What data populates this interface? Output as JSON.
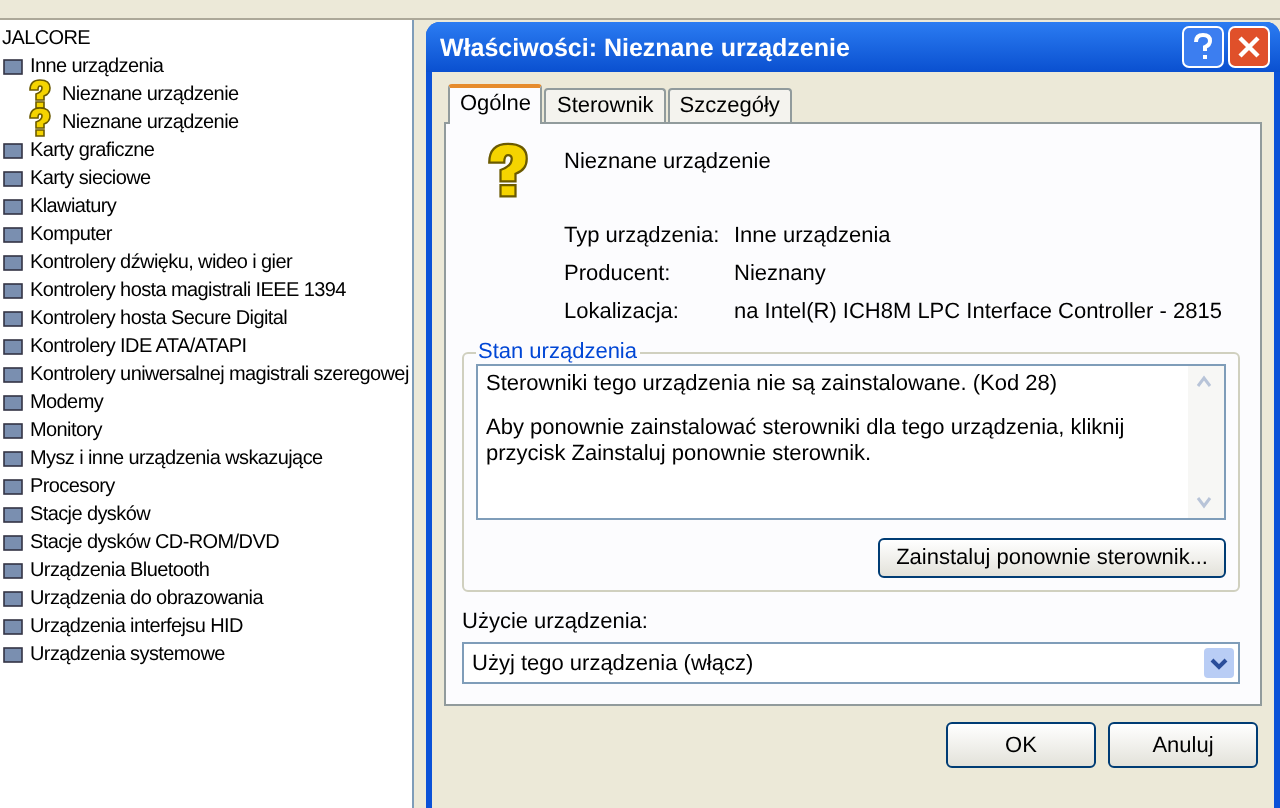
{
  "tree": {
    "label": "JALCORE",
    "children": [
      {
        "label": "Inne urządzenia",
        "children": [
          {
            "label": "Nieznane urządzenie",
            "kind": "unknown"
          },
          {
            "label": "Nieznane urządzenie",
            "kind": "unknown"
          }
        ]
      },
      {
        "label": "Karty graficzne"
      },
      {
        "label": "Karty sieciowe"
      },
      {
        "label": "Klawiatury"
      },
      {
        "label": "Komputer"
      },
      {
        "label": "Kontrolery dźwięku, wideo i gier"
      },
      {
        "label": "Kontrolery hosta magistrali IEEE 1394"
      },
      {
        "label": "Kontrolery hosta Secure Digital"
      },
      {
        "label": "Kontrolery IDE ATA/ATAPI"
      },
      {
        "label": "Kontrolery uniwersalnej magistrali szeregowej"
      },
      {
        "label": "Modemy"
      },
      {
        "label": "Monitory"
      },
      {
        "label": "Mysz i inne urządzenia wskazujące"
      },
      {
        "label": "Procesory"
      },
      {
        "label": "Stacje dysków"
      },
      {
        "label": "Stacje dysków CD-ROM/DVD"
      },
      {
        "label": "Urządzenia Bluetooth"
      },
      {
        "label": "Urządzenia do obrazowania"
      },
      {
        "label": "Urządzenia interfejsu HID"
      },
      {
        "label": "Urządzenia systemowe"
      }
    ]
  },
  "dialog": {
    "title": "Właściwości: Nieznane urządzenie",
    "tabs": [
      {
        "label": "Ogólne",
        "selected": true
      },
      {
        "label": "Sterownik",
        "selected": false
      },
      {
        "label": "Szczegóły",
        "selected": false
      }
    ],
    "device_name": "Nieznane urządzenie",
    "properties": [
      {
        "label": "Typ urządzenia:",
        "value": "Inne urządzenia"
      },
      {
        "label": "Producent:",
        "value": "Nieznany"
      },
      {
        "label": "Lokalizacja:",
        "value": "na Intel(R) ICH8M LPC Interface Controller - 2815"
      }
    ],
    "status_group": {
      "title": "Stan urządzenia",
      "lines": [
        "Sterowniki tego urządzenia nie są zainstalowane. (Kod 28)",
        "Aby ponownie zainstalować sterowniki dla tego urządzenia, kliknij przycisk Zainstaluj ponownie sterownik."
      ],
      "button": "Zainstaluj ponownie sterownik..."
    },
    "usage": {
      "label": "Użycie urządzenia:",
      "value": "Użyj tego urządzenia (włącz)"
    },
    "buttons": [
      "OK",
      "Anuluj"
    ]
  }
}
